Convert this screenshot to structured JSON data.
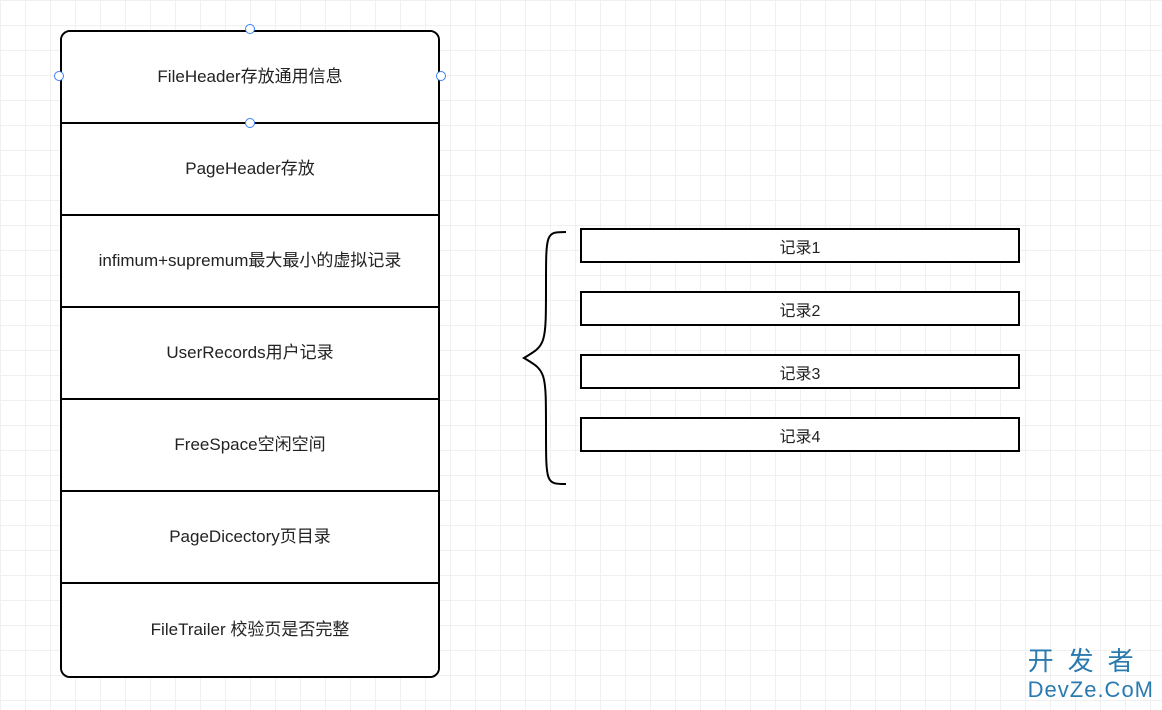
{
  "stack": {
    "rows": [
      {
        "label": "FileHeader存放通用信息"
      },
      {
        "label": "PageHeader存放"
      },
      {
        "label": "infimum+supremum最大最小的虚拟记录"
      },
      {
        "label": "UserRecords用户记录"
      },
      {
        "label": "FreeSpace空闲空间"
      },
      {
        "label": "PageDicectory页目录"
      },
      {
        "label": "FileTrailer 校验页是否完整"
      }
    ]
  },
  "records": {
    "items": [
      {
        "label": "记录1"
      },
      {
        "label": "记录2"
      },
      {
        "label": "记录3"
      },
      {
        "label": "记录4"
      }
    ]
  },
  "watermark": {
    "line1": "开发者",
    "line2": "DevZe.CoM"
  },
  "chart_data": {
    "type": "table",
    "title": "InnoDB Page Structure",
    "page_sections": [
      "FileHeader存放通用信息",
      "PageHeader存放",
      "infimum+supremum最大最小的虚拟记录",
      "UserRecords用户记录",
      "FreeSpace空闲空间",
      "PageDicectory页目录",
      "FileTrailer 校验页是否完整"
    ],
    "user_records_expansion": [
      "记录1",
      "记录2",
      "记录3",
      "记录4"
    ],
    "relation": "UserRecords用户记录 → [记录1, 记录2, 记录3, 记录4]"
  }
}
